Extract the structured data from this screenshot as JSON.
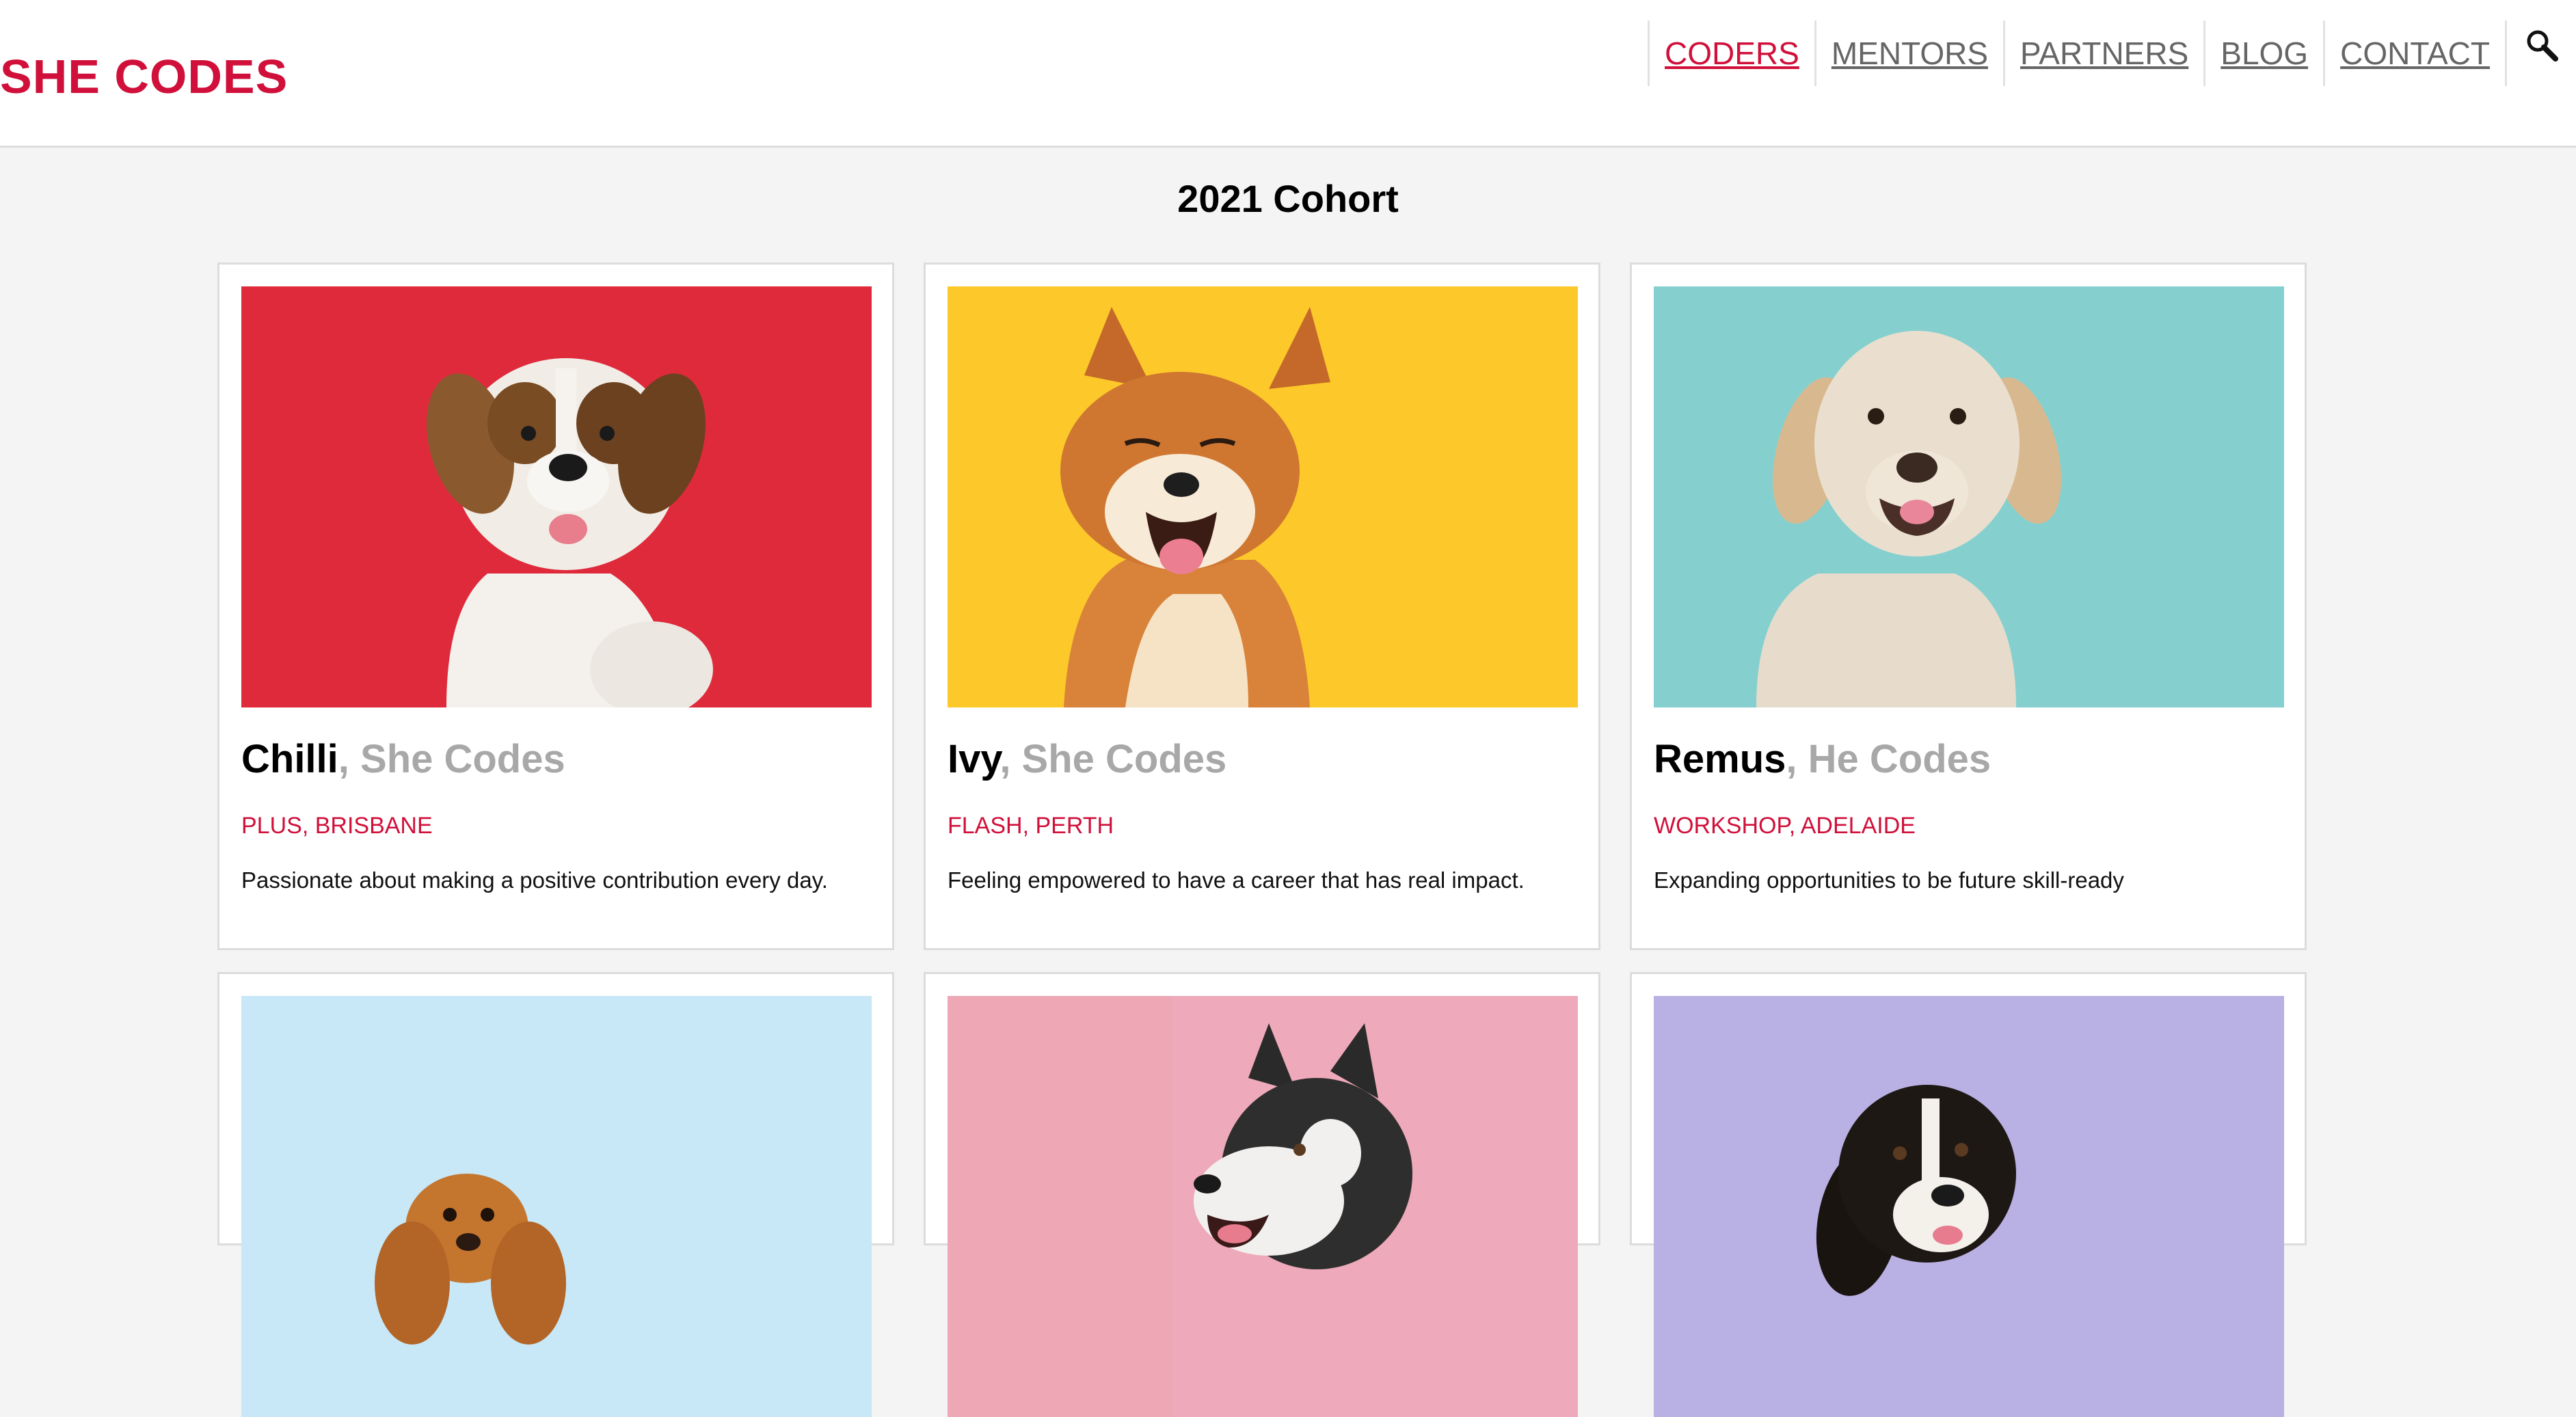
{
  "header": {
    "logo": "SHE CODES",
    "nav": [
      "CODERS",
      "MENTORS",
      "PARTNERS",
      "BLOG",
      "CONTACT"
    ],
    "active_nav": "CODERS",
    "search_icon": "search-icon"
  },
  "page_title": "2021 Cohort",
  "cards": [
    {
      "name": "Chilli",
      "org": ", She Codes",
      "program": "PLUS, BRISBANE",
      "quote": "Passionate about making a positive contribution every day.",
      "bg": "#df2a3c",
      "dog": "saint-bernard-puppy"
    },
    {
      "name": "Ivy",
      "org": ", She Codes",
      "program": "FLASH, PERTH",
      "quote": "Feeling empowered to have a career that has real impact.",
      "bg": "#fdc82a",
      "dog": "shiba-inu"
    },
    {
      "name": "Remus",
      "org": ", He Codes",
      "program": "WORKSHOP, ADELAIDE",
      "quote": "Expanding opportunities to be future skill-ready",
      "bg": "#85d0cf",
      "dog": "labrador"
    },
    {
      "name": "",
      "org": "",
      "program": "",
      "quote": "",
      "bg": "#c8e7f7",
      "dog": "cocker-spaniel-puppy"
    },
    {
      "name": "",
      "org": "",
      "program": "",
      "quote": "",
      "bg": "#eda7b5",
      "dog": "husky"
    },
    {
      "name": "",
      "org": "",
      "program": "",
      "quote": "",
      "bg": "#b9b0e3",
      "dog": "bernese-puppy"
    }
  ],
  "colors": {
    "brand": "#d0103a",
    "muted": "#a8a8a8",
    "page_bg": "#f4f4f4"
  }
}
